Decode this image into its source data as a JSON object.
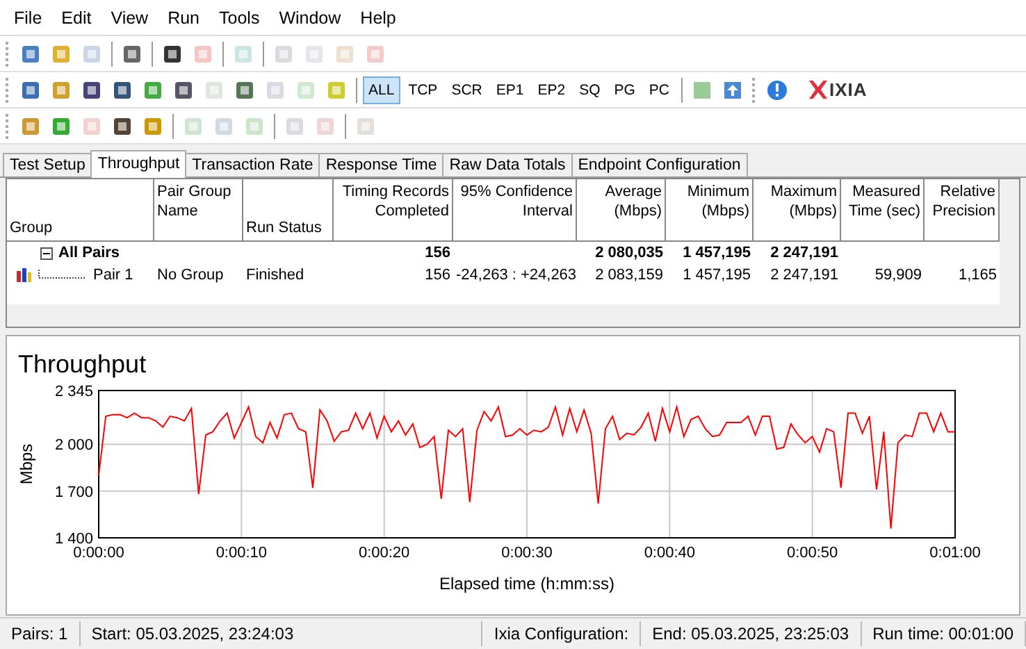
{
  "menu": [
    "File",
    "Edit",
    "View",
    "Run",
    "Tools",
    "Window",
    "Help"
  ],
  "toolbar_1": [
    {
      "disabled": false
    },
    {
      "disabled": false
    },
    {
      "disabled": true
    },
    {
      "disabled": false
    },
    {
      "disabled": false
    },
    {
      "disabled": true
    },
    {
      "disabled": true
    },
    {
      "disabled": true
    },
    {
      "disabled": true
    },
    {
      "disabled": true
    },
    {
      "disabled": true
    }
  ],
  "toolbar_2": {
    "icons": [
      {
        "disabled": false
      },
      {
        "disabled": false
      },
      {
        "disabled": false
      },
      {
        "disabled": false
      },
      {
        "disabled": false
      },
      {
        "disabled": false
      },
      {
        "disabled": true
      },
      {
        "disabled": false
      },
      {
        "disabled": true
      },
      {
        "disabled": true
      },
      {
        "disabled": false
      }
    ],
    "filters": [
      {
        "label": "ALL",
        "selected": true
      },
      {
        "label": "TCP",
        "selected": false
      },
      {
        "label": "SCR",
        "selected": false
      },
      {
        "label": "EP1",
        "selected": false
      },
      {
        "label": "EP2",
        "selected": false
      },
      {
        "label": "SQ",
        "selected": false
      },
      {
        "label": "PG",
        "selected": false
      },
      {
        "label": "PC",
        "selected": false
      }
    ],
    "logo": "IXIA"
  },
  "toolbar_3": [
    {
      "disabled": false
    },
    {
      "disabled": false
    },
    {
      "disabled": true
    },
    {
      "disabled": false
    },
    {
      "disabled": false
    },
    {
      "disabled": true
    },
    {
      "disabled": true
    },
    {
      "disabled": true
    },
    {
      "disabled": true
    },
    {
      "disabled": true
    },
    {
      "disabled": true
    }
  ],
  "tabs": [
    {
      "label": "Test Setup",
      "selected": false
    },
    {
      "label": "Throughput",
      "selected": true
    },
    {
      "label": "Transaction Rate",
      "selected": false
    },
    {
      "label": "Response Time",
      "selected": false
    },
    {
      "label": "Raw Data Totals",
      "selected": false
    },
    {
      "label": "Endpoint Configuration",
      "selected": false
    }
  ],
  "table": {
    "columns": [
      "Group",
      "Pair Group Name",
      "Run Status",
      "Timing Records Completed",
      "95% Confidence Interval",
      "Average (Mbps)",
      "Minimum (Mbps)",
      "Maximum (Mbps)",
      "Measured Time (sec)",
      "Relative Precision"
    ],
    "rows": [
      {
        "expanded": true,
        "cells": [
          "All Pairs",
          "",
          "",
          "156",
          "",
          "2 080,035",
          "1 457,195",
          "2 247,191",
          "",
          ""
        ],
        "children": [
          {
            "cells": [
              "Pair 1",
              "No Group",
              "Finished",
              "156",
              "-24,263 : +24,263",
              "2 083,159",
              "1 457,195",
              "2 247,191",
              "59,909",
              "1,165"
            ]
          }
        ]
      }
    ]
  },
  "chart": {
    "chart_data": {
      "type": "line",
      "title": "Throughput",
      "xlabel": "Elapsed time (h:mm:ss)",
      "ylabel": "Mbps",
      "x": [
        0,
        0.5,
        1,
        1.5,
        2,
        2.5,
        3,
        3.5,
        4,
        4.5,
        5,
        5.5,
        6,
        6.5,
        7,
        7.5,
        8,
        8.5,
        9,
        9.5,
        10,
        10.5,
        11,
        11.5,
        12,
        12.5,
        13,
        13.5,
        14,
        14.5,
        15,
        15.5,
        16,
        16.5,
        17,
        17.5,
        18,
        18.5,
        19,
        19.5,
        20,
        20.5,
        21,
        21.5,
        22,
        22.5,
        23,
        23.5,
        24,
        24.5,
        25,
        25.5,
        26,
        26.5,
        27,
        27.5,
        28,
        28.5,
        29,
        29.5,
        30,
        30.5,
        31,
        31.5,
        32,
        32.5,
        33,
        33.5,
        34,
        34.5,
        35,
        35.5,
        36,
        36.5,
        37,
        37.5,
        38,
        38.5,
        39,
        39.5,
        40,
        40.5,
        41,
        41.5,
        42,
        42.5,
        43,
        43.5,
        44,
        44.5,
        45,
        45.5,
        46,
        46.5,
        47,
        47.5,
        48,
        48.5,
        49,
        49.5,
        50,
        50.5,
        51,
        51.5,
        52,
        52.5,
        53,
        53.5,
        54,
        54.5,
        55,
        55.5,
        56,
        56.5,
        57,
        57.5,
        58,
        58.5,
        59,
        59.5,
        60
      ],
      "grid": true,
      "series": [
        {
          "color": "#ff0000",
          "values": [
            1800,
            2180,
            2190,
            2190,
            2170,
            2200,
            2170,
            2170,
            2150,
            2110,
            2180,
            2170,
            2150,
            2230,
            1680,
            2060,
            2080,
            2150,
            2200,
            2040,
            2140,
            2240,
            2050,
            2010,
            2140,
            2040,
            2190,
            2200,
            2100,
            2080,
            1720,
            2220,
            2150,
            2020,
            2080,
            2090,
            2200,
            2100,
            2200,
            2040,
            2180,
            2080,
            2150,
            2060,
            2130,
            1980,
            2000,
            2050,
            1650,
            2090,
            2050,
            2100,
            1630,
            2090,
            2210,
            2150,
            2240,
            2050,
            2060,
            2100,
            2060,
            2090,
            2080,
            2110,
            2240,
            2060,
            2230,
            2080,
            2220,
            2070,
            1620,
            2100,
            2180,
            2030,
            2070,
            2060,
            2110,
            2200,
            2020,
            2230,
            2080,
            2240,
            2050,
            2160,
            2180,
            2100,
            2050,
            2060,
            2140,
            2140,
            2140,
            2180,
            2060,
            2180,
            2180,
            1970,
            1980,
            2130,
            2060,
            2010,
            2050,
            1950,
            2100,
            2080,
            1720,
            2200,
            2200,
            2070,
            2180,
            1710,
            2080,
            1460,
            2010,
            2060,
            2050,
            2200,
            2200,
            2080,
            2200,
            2080,
            2080
          ]
        }
      ],
      "xlim": [
        0,
        60
      ],
      "ylim": [
        1400,
        2345
      ],
      "xticks": [
        {
          "value": 0,
          "label": "0:00:00"
        },
        {
          "value": 10,
          "label": "0:00:10"
        },
        {
          "value": 20,
          "label": "0:00:20"
        },
        {
          "value": 30,
          "label": "0:00:30"
        },
        {
          "value": 40,
          "label": "0:00:40"
        },
        {
          "value": 50,
          "label": "0:00:50"
        },
        {
          "value": 60,
          "label": "0:01:00"
        }
      ],
      "yticks": [
        {
          "value": 1400,
          "label": "1 400"
        },
        {
          "value": 1700,
          "label": "1 700"
        },
        {
          "value": 2000,
          "label": "2 000"
        },
        {
          "value": 2345,
          "label": "2 345"
        }
      ]
    }
  },
  "status_bar": [
    "Pairs: 1",
    "Start: 05.03.2025, 23:24:03",
    "Ixia Configuration:",
    "End: 05.03.2025, 23:25:03",
    "Run time: 00:01:00"
  ]
}
